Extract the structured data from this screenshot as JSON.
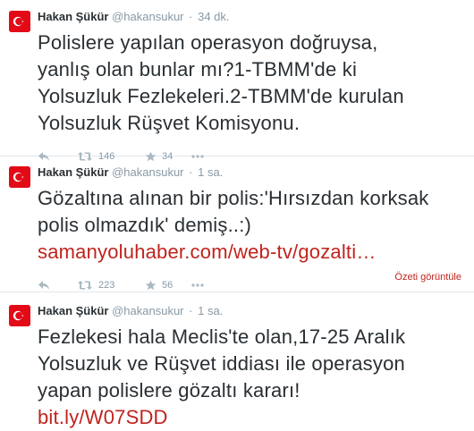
{
  "colors": {
    "accent": "#c0231d",
    "muted": "#8899a6",
    "avatar_red": "#e30a17"
  },
  "tweets": [
    {
      "name": "Hakan Şükür",
      "handle": "@hakansukur",
      "time": "34 dk.",
      "text_lines": [
        "Polislere yapılan operasyon doğruysa,",
        "yanlış olan bunlar mı?1-TBMM'de ki",
        "Yolsuzluk Fezlekeleri.2-TBMM'de kurulan",
        "Yolsuzluk Rüşvet Komisyonu."
      ],
      "retweets": "146",
      "favorites": "34"
    },
    {
      "name": "Hakan Şükür",
      "handle": "@hakansukur",
      "time": "1 sa.",
      "text_lines": [
        "Gözaltına alınan bir polis:'Hırsızdan korksak",
        "polis olmazdık' demiş..:)"
      ],
      "link": "samanyoluhaber.com/web-tv/gozalti…",
      "retweets": "223",
      "favorites": "56",
      "summary_label": "Özeti görüntüle"
    },
    {
      "name": "Hakan Şükür",
      "handle": "@hakansukur",
      "time": "1 sa.",
      "text_lines": [
        "Fezlekesi hala Meclis'te olan,17-25 Aralık",
        "Yolsuzluk ve Rüşvet iddiası ile operasyon",
        "yapan polislere gözaltı kararı!"
      ],
      "link": "bit.ly/W07SDD"
    }
  ],
  "icons": {
    "reply": "reply-icon",
    "retweet": "retweet-icon",
    "favorite": "star-icon",
    "more": "more-icon",
    "avatar": "turkish-flag-avatar"
  }
}
